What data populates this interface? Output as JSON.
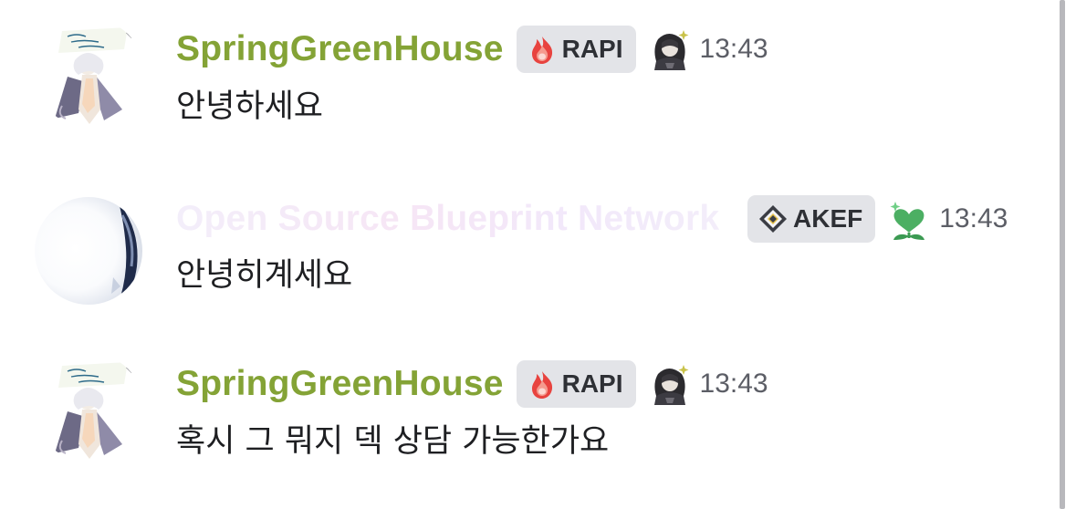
{
  "messages": [
    {
      "author": "SpringGreenHouse",
      "author_style": "green",
      "tag": {
        "icon": "fire-tag-icon",
        "label": "RAPI"
      },
      "role_icon": "dark-character-icon",
      "time": "13:43",
      "text": "안녕하세요"
    },
    {
      "author": "Open Source Blueprint Network",
      "author_style": "faded-gradient",
      "tag": {
        "icon": "diamond-tag-icon",
        "label": "AKEF"
      },
      "role_icon": "green-heart-sprout-icon",
      "time": "13:43",
      "text": "안녕히계세요"
    },
    {
      "author": "SpringGreenHouse",
      "author_style": "green",
      "tag": {
        "icon": "fire-tag-icon",
        "label": "RAPI"
      },
      "role_icon": "dark-character-icon",
      "time": "13:43",
      "text": "혹시 그 뭐지 덱 상담 가능한가요"
    }
  ],
  "colors": {
    "username_green": "#84a336",
    "tag_background": "#e3e4e8",
    "timestamp": "#5c5e66",
    "message_text": "#1e1f22",
    "scrollbar": "#b8b8bc"
  }
}
